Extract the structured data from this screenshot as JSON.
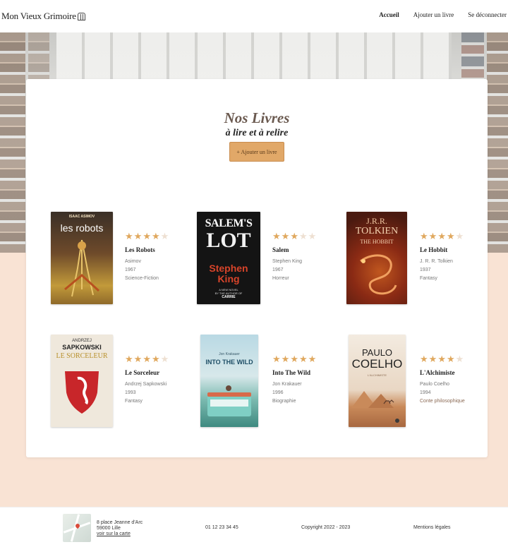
{
  "header": {
    "logo_text": "Mon Vieux Grimoire",
    "nav": [
      "Accueil",
      "Ajouter un livre",
      "Se déconnecter"
    ]
  },
  "main": {
    "title": "Nos Livres",
    "subtitle": "à lire et à relire",
    "add_button": "+ Ajouter un livre"
  },
  "books": [
    {
      "title": "Les Robots",
      "author": "Asimov",
      "year": "1967",
      "genre": "Science-Fiction",
      "rating": 4,
      "cover_text": [
        "ISAAC ASIMOV",
        "les robots"
      ]
    },
    {
      "title": "Salem",
      "author": "Stephen King",
      "year": "1967",
      "genre": "Horreur",
      "rating": 3,
      "cover_text": [
        "SALEM'S",
        "LOT",
        "Stephen",
        "King",
        "A NEW NOVEL",
        "BY THE AUTHOR OF",
        "CARRIE"
      ]
    },
    {
      "title": "Le Hobbit",
      "author": "J. R. R. Tolkien",
      "year": "1937",
      "genre": "Fantasy",
      "rating": 4,
      "cover_text": [
        "J.R.R.",
        "TOLKIEN",
        "THE HOBBIT"
      ]
    },
    {
      "title": "Le Sorceleur",
      "author": "Andrzej Sapkowski",
      "year": "1993",
      "genre": "Fantasy",
      "rating": 4,
      "cover_text": [
        "ANDRZEJ",
        "SAPKOWSKI",
        "LE SORCELEUR"
      ]
    },
    {
      "title": "Into The Wild",
      "author": "Jon Krakauer",
      "year": "1996",
      "genre": "Biographie",
      "rating": 5,
      "cover_text": [
        "Jon Krakauer",
        "INTO THE WILD"
      ]
    },
    {
      "title": "L'Alchimiste",
      "author": "Paulo Coelho",
      "year": "1994",
      "genre": "Conte philosophique",
      "rating": 4,
      "cover_text": [
        "PAULO",
        "COELHO",
        "L'ALCHIMISTE"
      ]
    }
  ],
  "footer": {
    "address_line1": "8 place Jeanne d'Arc",
    "address_line2": "59000 Lille",
    "map_link": "voir sur la carte",
    "phone": "01 12 23 34 45",
    "copyright": "Copyright 2022 - 2023",
    "legal": "Mentions légales"
  },
  "colors": {
    "accent": "#e1a868",
    "star_on": "#e0a85e",
    "star_off": "#eee0d2",
    "peach_bg": "#f9e3d4"
  },
  "icons": [
    "logo-book-icon",
    "star-icon",
    "map-pin-icon"
  ]
}
